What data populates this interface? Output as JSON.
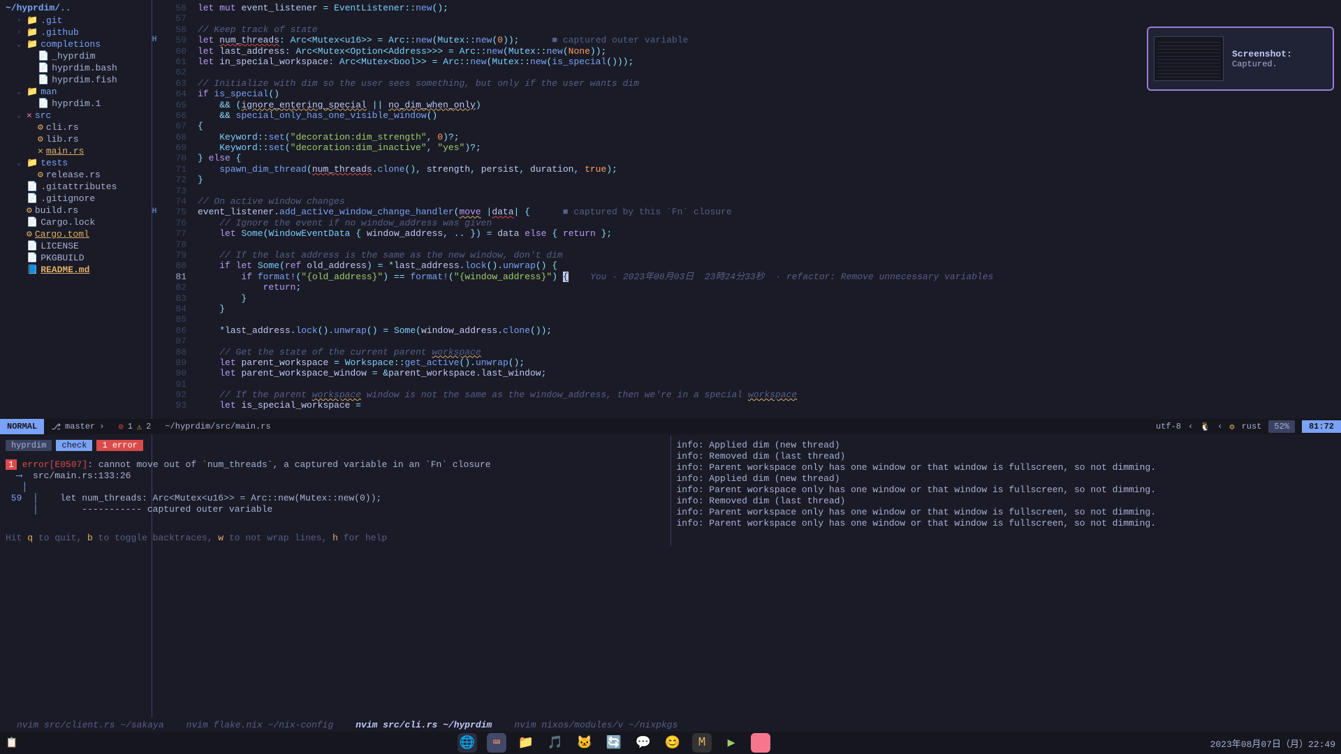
{
  "fileTree": {
    "root": "~/hyprdim/..",
    "items": [
      {
        "chev": "›",
        "icon": "folder",
        "label": ".git",
        "indent": 1,
        "folder": true
      },
      {
        "chev": "›",
        "icon": "folder",
        "label": ".github",
        "indent": 1,
        "folder": true
      },
      {
        "chev": "⌄",
        "icon": "folder",
        "label": "completions",
        "indent": 1,
        "folder": true
      },
      {
        "chev": "",
        "icon": "file",
        "label": "_hyprdim",
        "indent": 2
      },
      {
        "chev": "",
        "icon": "file",
        "label": "hyprdim.bash",
        "indent": 2
      },
      {
        "chev": "",
        "icon": "file",
        "label": "hyprdim.fish",
        "indent": 2
      },
      {
        "chev": "⌄",
        "icon": "folder",
        "label": "man",
        "indent": 1,
        "folder": true
      },
      {
        "chev": "",
        "icon": "file",
        "label": "hyprdim.1",
        "indent": 2
      },
      {
        "chev": "⌄",
        "icon": "x",
        "label": "src",
        "indent": 1,
        "folder": true
      },
      {
        "chev": "",
        "icon": "rust",
        "label": "cli.rs",
        "indent": 2
      },
      {
        "chev": "",
        "icon": "rust",
        "label": "lib.rs",
        "indent": 2
      },
      {
        "chev": "",
        "icon": "xrust",
        "label": "main.rs",
        "indent": 2,
        "modified": true
      },
      {
        "chev": "⌄",
        "icon": "folder",
        "label": "tests",
        "indent": 1,
        "folder": true
      },
      {
        "chev": "",
        "icon": "rust",
        "label": "release.rs",
        "indent": 2
      },
      {
        "chev": "",
        "icon": "file",
        "label": ".gitattributes",
        "indent": 1
      },
      {
        "chev": "",
        "icon": "file",
        "label": ".gitignore",
        "indent": 1
      },
      {
        "chev": "",
        "icon": "rust",
        "label": "build.rs",
        "indent": 1
      },
      {
        "chev": "",
        "icon": "file",
        "label": "Cargo.lock",
        "indent": 1
      },
      {
        "chev": "",
        "icon": "rust",
        "label": "Cargo.toml",
        "indent": 1,
        "modified": true
      },
      {
        "chev": "",
        "icon": "file",
        "label": "LICENSE",
        "indent": 1
      },
      {
        "chev": "",
        "icon": "file",
        "label": "PKGBUILD",
        "indent": 1
      },
      {
        "chev": "",
        "icon": "md",
        "label": "README.md",
        "indent": 1,
        "modified": true,
        "bold": true
      }
    ]
  },
  "lineStart": 56,
  "lineEnd": 93,
  "currentLine": 81,
  "gutterMarks": {
    "59": "H",
    "75": "H"
  },
  "inlayHints": {
    "59": "■ captured outer variable",
    "75": "■ captured by this `Fn` closure"
  },
  "blame": {
    "81": "You · 2023年08月03日  23時24分33秒  · refactor: Remove unnecessary variables"
  },
  "statusline": {
    "mode": "NORMAL",
    "branch": "master",
    "errors": "1",
    "warnings": "2",
    "path": "~/hyprdim/src/main.rs",
    "encoding": "utf-8",
    "filetype": "rust",
    "percent": "52%",
    "pos": "81:72"
  },
  "diagnostics": {
    "project": "hyprdim",
    "action": "check",
    "error_count": "1 error",
    "err_num": "1",
    "err_code": "error[E0507]",
    "err_msg": ": cannot move out of `num_threads`, a captured variable in an `Fn` closure",
    "err_loc": "src/main.rs:133:26",
    "context_line1": "    let num_threads: Arc<Mutex<u16>> = Arc::new(Mutex::new(0));",
    "context_line2": "    ----------- captured outer variable",
    "help": {
      "prefix": "Hit ",
      "q": "q",
      "q_desc": " to quit, ",
      "b": "b",
      "b_desc": " to toggle backtraces, ",
      "w": "w",
      "w_desc": " to not wrap lines, ",
      "h": "h",
      "h_desc": " for help"
    }
  },
  "logs": [
    "info: Applied dim (new thread)",
    "info: Removed dim (last thread)",
    "info: Parent workspace only has one window or that window is fullscreen, so not dimming.",
    "info: Applied dim (new thread)",
    "info: Parent workspace only has one window or that window is fullscreen, so not dimming.",
    "info: Removed dim (last thread)",
    "info: Parent workspace only has one window or that window is fullscreen, so not dimming.",
    "info: Parent workspace only has one window or that window is fullscreen, so not dimming."
  ],
  "tmux": [
    {
      "label": "nvim src/client.rs ~/sakaya",
      "active": false
    },
    {
      "label": "nvim flake.nix ~/nix-config",
      "active": false
    },
    {
      "label": "nvim src/cli.rs ~/hyprdim",
      "active": true
    },
    {
      "label": "nvim nixos/modules/v ~/nixpkgs",
      "active": false
    }
  ],
  "taskbar": {
    "datetime": "2023年08月07日（月）22:49"
  },
  "notification": {
    "title": "Screenshot:",
    "body": "Captured."
  }
}
